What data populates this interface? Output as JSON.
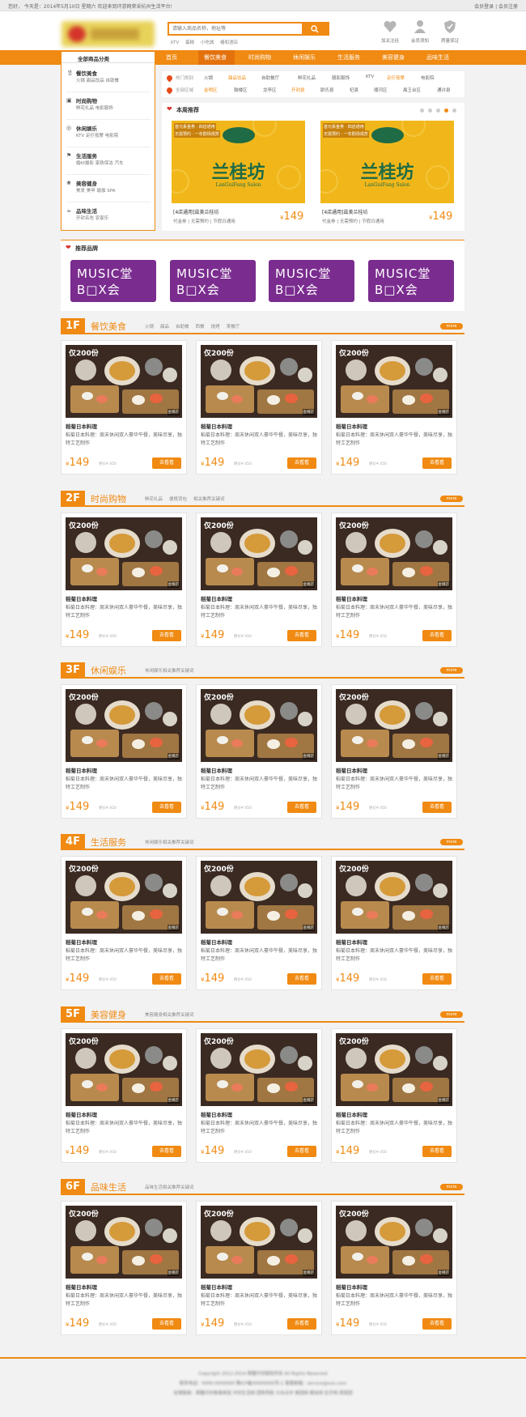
{
  "topbar": {
    "left_text": "您好，  今天是：2014年5月10日 星期六  欢迎来到环游网荣采杭州生活平台!",
    "right_text": "会员登录  |  会员注册"
  },
  "header": {
    "logo_text": "粥膳开封",
    "search_placeholder": "请输入商品名称，地址等",
    "hotwords": [
      "KTV",
      "蛋糕",
      "小吃城",
      "椿和酒店"
    ],
    "icons": [
      {
        "label": "加关注经",
        "icon": "heart-icon"
      },
      {
        "label": "会员须知",
        "icon": "person-icon"
      },
      {
        "label": "质量保证",
        "icon": "shield-icon"
      }
    ]
  },
  "nav": {
    "items": [
      "首页",
      "餐饮美食",
      "时尚购物",
      "休闲娱乐",
      "生活服务",
      "美容健身",
      "品味生活"
    ],
    "active_index": 1
  },
  "categories": {
    "title": "全部商品分类",
    "items": [
      {
        "title": "餐饮美食",
        "sub": "火锅  甜品饮品  自助餐",
        "icon": "fork-icon"
      },
      {
        "title": "时尚购物",
        "sub": "鲜花礼品  电影服饰",
        "icon": "bag-icon"
      },
      {
        "title": "休闲娱乐",
        "sub": "KTV  足疗按摩  电影院",
        "icon": "game-icon"
      },
      {
        "title": "生活服务",
        "sub": "婚纱摄影  家政保洁  汽车",
        "icon": "service-icon"
      },
      {
        "title": "美容健身",
        "sub": "美发  美甲  瑜伽  SPA",
        "icon": "beauty-icon"
      },
      {
        "title": "品味生活",
        "sub": "开封名吃  农家乐",
        "icon": "taste-icon"
      }
    ]
  },
  "filters": {
    "row1_label": "热门类别",
    "row1": [
      "火锅",
      "甜品饮品",
      "自助餐厅",
      "鲜花礼品",
      "靓影服饰",
      "KTV",
      "足疗按摩",
      "电影院"
    ],
    "row1_highlight": [
      1,
      6
    ],
    "row2_label": "全部区域",
    "row2": [
      "金明区",
      "鼓楼区",
      "龙亭区",
      "开封县",
      "尉氏县",
      "杞县",
      "顺河区",
      "禹王台区",
      "通许县"
    ],
    "row2_highlight": [
      0,
      3
    ]
  },
  "recommend": {
    "title": "本周推荐",
    "items": [
      {
        "tag1": "首元系金券 · 四店通用",
        "tag2": "无需预约 · 一年剧场观赏",
        "brand_cn": "兰桂坊",
        "brand_en": "LanGuiFang Salon",
        "caption": "[4店通用]兹美兰桂坊",
        "sub": "代金券 | 无需预约 | 节假日通用",
        "price": "149"
      },
      {
        "tag1": "首元系金券 · 四店通用",
        "tag2": "无需预约 · 一年剧场观赏",
        "brand_cn": "兰桂坊",
        "brand_en": "LanGuiFang Salon",
        "caption": "[4店通用]兹美兰桂坊",
        "sub": "代金券 | 无需预约 | 节假日通用",
        "price": "149"
      }
    ],
    "dots": 5,
    "active_dot": 3
  },
  "brands": {
    "title": "推荐品牌",
    "items": [
      {
        "line1": "MUSIC堂",
        "line2": "B□X会"
      },
      {
        "line1": "MUSIC堂",
        "line2": "B□X会"
      },
      {
        "line1": "MUSIC堂",
        "line2": "B□X会"
      },
      {
        "line1": "MUSIC堂",
        "line2": "B□X会"
      }
    ]
  },
  "floors": [
    {
      "num": "1F",
      "name": "餐饮美食",
      "keys": [
        "火锅",
        "甜品",
        "自助餐",
        "西餐",
        "烧烤",
        "茶餐厅"
      ],
      "more": "more"
    },
    {
      "num": "2F",
      "name": "时尚购物",
      "keys": [
        "鲜花礼品",
        "便携背包",
        "相关推荐关键词"
      ],
      "more": "more"
    },
    {
      "num": "3F",
      "name": "休闲娱乐",
      "keys": [
        "休闲娱乐相关推荐关键词"
      ],
      "more": "more"
    },
    {
      "num": "4F",
      "name": "生活服务",
      "keys": [
        "休闲娱乐相关推荐关键词"
      ],
      "more": "more"
    },
    {
      "num": "5F",
      "name": "美容健身",
      "keys": [
        "美容健身相关推荐关键词"
      ],
      "more": "more"
    },
    {
      "num": "6F",
      "name": "品味生活",
      "keys": [
        "品味生活相关推荐关键词"
      ],
      "more": "more"
    }
  ],
  "product": {
    "badge": "仅200份",
    "sign": "金樽店",
    "title": "稻菊日本料理",
    "desc": "稻菊日本料理：周末休闲双人豪华午餐，美味尽享，独特工艺制作",
    "price": "149",
    "orig": "原价¥ 450",
    "button": "去看看"
  },
  "footer": {
    "line1": "Copyright 2012-2014 粥膳开封版权所有 All Rights Reserved",
    "line2": "联系电话：0000-0000000  豫ICP备00000000号-1  客服邮箱：service@xxx.com",
    "line3": "友情链接：粥膳开封美食频道 开封生活网 团购导航 大众点评 美团网 糯米网 拉手网 窝窝团"
  },
  "colors": {
    "accent": "#f08a12",
    "nav_active": "#e4720c",
    "brand_purple": "#7a2c8f",
    "banner_yellow": "#f1b71a",
    "banner_green": "#1f6b45"
  }
}
